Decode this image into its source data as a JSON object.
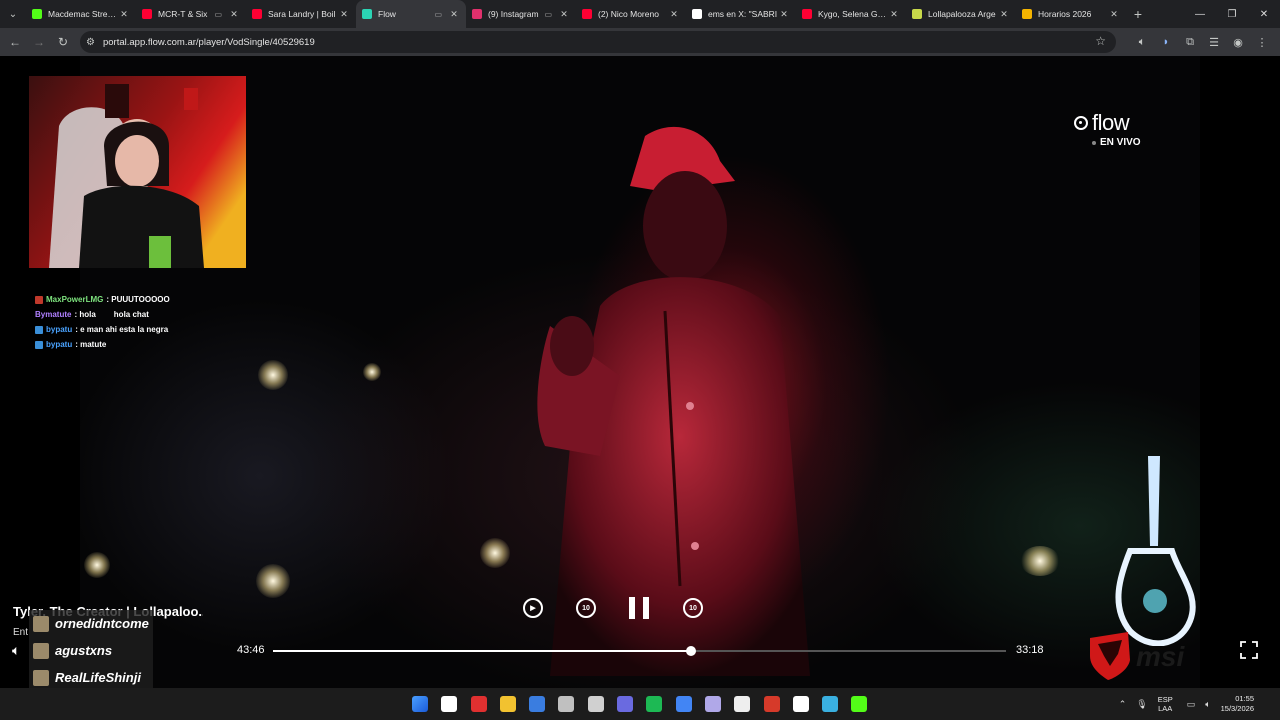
{
  "browser": {
    "tabs": [
      {
        "title": "Macdemac Stream",
        "color": "#53fc18",
        "active": false
      },
      {
        "title": "MCR-T & Six",
        "color": "#ff0033",
        "active": false,
        "cast": true
      },
      {
        "title": "Sara Landry | Boil",
        "color": "#ff0033",
        "active": false
      },
      {
        "title": "Flow",
        "color": "#2bd4b4",
        "active": true,
        "cast": true
      },
      {
        "title": "(9) Instagram",
        "color": "#e1306c",
        "active": false,
        "cast": true
      },
      {
        "title": "(2) Nico Moreno",
        "color": "#ff0033",
        "active": false
      },
      {
        "title": "ems en X: \"SABRI",
        "color": "#ffffff",
        "active": false
      },
      {
        "title": "Kygo, Selena Gom",
        "color": "#ff0033",
        "active": false
      },
      {
        "title": "Lollapalooza Arge",
        "color": "#c8d94a",
        "active": false
      },
      {
        "title": "Horarios 2026",
        "color": "#f5b400",
        "active": false
      }
    ],
    "url": "portal.app.flow.com.ar/player/VodSingle/40529619"
  },
  "overlay": {
    "chat": [
      {
        "user": "MaxPowerLMG",
        "user_color": "#7ee37e",
        "text": ": PUUUTOOOOO",
        "badge_color": "#c0392b"
      },
      {
        "user": "Bymatute",
        "user_color": "#b080ff",
        "text": ": hola",
        "text2": "hola chat",
        "badge_color": "none"
      },
      {
        "user": "bypatu",
        "user_color": "#4aa3ff",
        "text": ": e man ahi esta la negra",
        "badge_color": "#3a8fd8"
      },
      {
        "user": "bypatu",
        "user_color": "#4aa3ff",
        "text": ": matute",
        "badge_color": "#3a8fd8"
      }
    ],
    "followers": [
      "ornedidntcome",
      "agustxns",
      "RealLifeShinji"
    ]
  },
  "player": {
    "logo_word": "flow",
    "live_label": "EN VIVO",
    "title": "Tyler, The Creator | Lollapaloo...",
    "subtitle": "Ent",
    "time_elapsed": "43:46",
    "time_remaining": "33:18",
    "progress_fraction": 0.57,
    "skip_back_label": "10",
    "skip_fwd_label": "10"
  },
  "taskbar": {
    "lang_top": "ESP",
    "lang_bottom": "LAA",
    "time": "01:55",
    "date": "15/3/2026",
    "app_colors": [
      "#2b6cd8",
      "#ffffff",
      "#e03030",
      "#f2c230",
      "#3a7de0",
      "#c0c0c0",
      "#d0d0d0",
      "#6a6ae0",
      "#1db954",
      "#4285f4",
      "#b0a8e8",
      "#eeeeee",
      "#d63a2a",
      "#ffffff",
      "#3ab0e0",
      "#53fc18"
    ]
  }
}
